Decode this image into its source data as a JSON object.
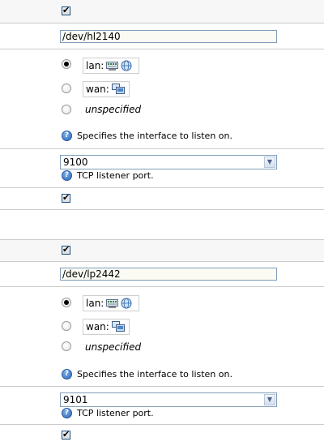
{
  "printers": [
    {
      "device": "/dev/hl2140",
      "interfaces": [
        {
          "label": "lan:",
          "icons": [
            "network-card-icon",
            "globe-icon"
          ],
          "selected": true
        },
        {
          "label": "wan:",
          "icons": [
            "wan-computer-icon"
          ],
          "selected": false
        },
        {
          "label": "unspecified",
          "selected": false
        }
      ],
      "interface_help": "Specifies the interface to listen on.",
      "port": "9100",
      "port_help": "TCP listener port."
    },
    {
      "device": "/dev/lp2442",
      "interfaces": [
        {
          "label": "lan:",
          "icons": [
            "network-card-icon",
            "globe-icon"
          ],
          "selected": true
        },
        {
          "label": "wan:",
          "icons": [
            "wan-computer-icon"
          ],
          "selected": false
        },
        {
          "label": "unspecified",
          "selected": false
        }
      ],
      "interface_help": "Specifies the interface to listen on.",
      "port": "9101",
      "port_help": "TCP listener port."
    }
  ],
  "colors": {
    "row_border": "#cccccc",
    "row_shade": "#f7f7f7",
    "input_border": "#7f9db9",
    "help_icon": "#2a64b8"
  }
}
